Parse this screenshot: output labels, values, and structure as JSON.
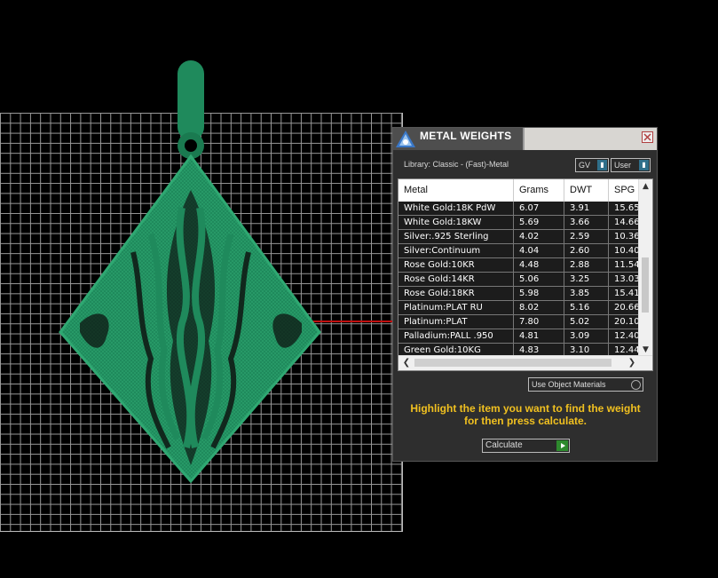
{
  "panel": {
    "title": "METAL WEIGHTS",
    "library": "Library: Classic - (Fast)-Metal",
    "gv_label": "GV",
    "user_label": "User",
    "columns": [
      "Metal",
      "Grams",
      "DWT",
      "SPG"
    ],
    "rows": [
      [
        "White Gold:18K PdW",
        "6.07",
        "3.91",
        "15.65"
      ],
      [
        "White Gold:18KW",
        "5.69",
        "3.66",
        "14.66"
      ],
      [
        "Silver:.925 Sterling",
        "4.02",
        "2.59",
        "10.36"
      ],
      [
        "Silver:Continuum",
        "4.04",
        "2.60",
        "10.40"
      ],
      [
        "Rose Gold:10KR",
        "4.48",
        "2.88",
        "11.54"
      ],
      [
        "Rose Gold:14KR",
        "5.06",
        "3.25",
        "13.03"
      ],
      [
        "Rose Gold:18KR",
        "5.98",
        "3.85",
        "15.41"
      ],
      [
        "Platinum:PLAT RU",
        "8.02",
        "5.16",
        "20.66"
      ],
      [
        "Platinum:PLAT",
        "7.80",
        "5.02",
        "20.10"
      ],
      [
        "Palladium:PALL .950",
        "4.81",
        "3.09",
        "12.40"
      ],
      [
        "Green Gold:10KG",
        "4.83",
        "3.10",
        "12.44"
      ]
    ],
    "materials_option": "Use Object Materials",
    "hint": "Highlight the item you want to find the weight for then press calculate.",
    "calculate_label": "Calculate"
  },
  "colors": {
    "model": "#1f8a5c",
    "hint": "#f0c020",
    "axis_x": "#c01010"
  }
}
